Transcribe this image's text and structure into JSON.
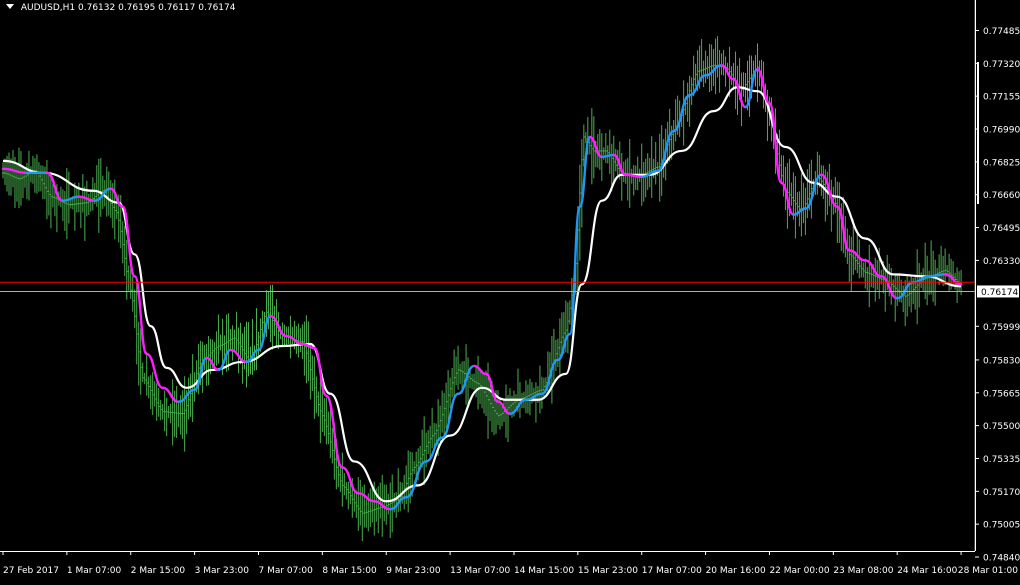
{
  "header": {
    "symbol": "AUDUSD,H1",
    "ohlc": "0.76132 0.76195 0.76117 0.76174"
  },
  "colors": {
    "background": "#000000",
    "axis": "#ffffff",
    "bars": "#4caf50",
    "ma_slow": "#ffffff",
    "ma_fast_down": "#ff1cff",
    "ma_fast_up": "#2196f3",
    "bid_line": "#ff0000",
    "price_line": "#b0b0b0",
    "price_label_bg": "#ffffff",
    "price_label_text": "#000000"
  },
  "chart_data": {
    "type": "line",
    "title": "",
    "series_style": "ohlc_bars_with_moving_averages",
    "current_price": 0.76174,
    "current_price_label": "0.76174",
    "bid_line": 0.7622,
    "ylim": [
      0.7484,
      0.7758
    ],
    "y_ticks": [
      0.77485,
      0.7732,
      0.77155,
      0.7699,
      0.76825,
      0.7666,
      0.76495,
      0.7633,
      0.75999,
      0.7583,
      0.75665,
      0.755,
      0.75335,
      0.7517,
      0.75005,
      0.7484
    ],
    "y_tick_labels": [
      "0.77485",
      "0.77320",
      "0.77155",
      "0.76990",
      "0.76825",
      "0.76660",
      "0.76495",
      "0.76330",
      "0.75999",
      "0.75830",
      "0.75665",
      "0.75500",
      "0.75335",
      "0.75170",
      "0.75005",
      "0.74840"
    ],
    "x_tick_labels": [
      "27 Feb 2017",
      "1 Mar 07:00",
      "2 Mar 15:00",
      "3 Mar 23:00",
      "7 Mar 07:00",
      "8 Mar 15:00",
      "9 Mar 23:00",
      "13 Mar 07:00",
      "14 Mar 15:00",
      "15 Mar 23:00",
      "17 Mar 07:00",
      "20 Mar 16:00",
      "22 Mar 00:00",
      "23 Mar 08:00",
      "24 Mar 16:00",
      "28 Mar 01:00"
    ],
    "x_tick_bars": [
      0,
      32,
      64,
      96,
      128,
      160,
      192,
      224,
      256,
      288,
      320,
      352,
      384,
      416,
      448,
      480
    ],
    "bar_count": 481,
    "price_path": [
      {
        "bar": 0,
        "price": 0.7677
      },
      {
        "bar": 8,
        "price": 0.7674
      },
      {
        "bar": 16,
        "price": 0.7678
      },
      {
        "bar": 24,
        "price": 0.7665
      },
      {
        "bar": 33,
        "price": 0.7661
      },
      {
        "bar": 42,
        "price": 0.7662
      },
      {
        "bar": 50,
        "price": 0.7668
      },
      {
        "bar": 57,
        "price": 0.7657
      },
      {
        "bar": 64,
        "price": 0.7618
      },
      {
        "bar": 70,
        "price": 0.7574
      },
      {
        "bar": 80,
        "price": 0.7557
      },
      {
        "bar": 90,
        "price": 0.7556
      },
      {
        "bar": 100,
        "price": 0.7583
      },
      {
        "bar": 108,
        "price": 0.759
      },
      {
        "bar": 116,
        "price": 0.7594
      },
      {
        "bar": 124,
        "price": 0.7582
      },
      {
        "bar": 132,
        "price": 0.7607
      },
      {
        "bar": 140,
        "price": 0.7595
      },
      {
        "bar": 150,
        "price": 0.7592
      },
      {
        "bar": 160,
        "price": 0.7555
      },
      {
        "bar": 170,
        "price": 0.752
      },
      {
        "bar": 180,
        "price": 0.7506
      },
      {
        "bar": 190,
        "price": 0.7509
      },
      {
        "bar": 198,
        "price": 0.7513
      },
      {
        "bar": 206,
        "price": 0.7529
      },
      {
        "bar": 216,
        "price": 0.7546
      },
      {
        "bar": 228,
        "price": 0.7578
      },
      {
        "bar": 238,
        "price": 0.7571
      },
      {
        "bar": 248,
        "price": 0.7555
      },
      {
        "bar": 258,
        "price": 0.7563
      },
      {
        "bar": 270,
        "price": 0.7568
      },
      {
        "bar": 282,
        "price": 0.7598
      },
      {
        "bar": 286,
        "price": 0.762
      },
      {
        "bar": 291,
        "price": 0.7695
      },
      {
        "bar": 296,
        "price": 0.7688
      },
      {
        "bar": 302,
        "price": 0.7688
      },
      {
        "bar": 310,
        "price": 0.7677
      },
      {
        "bar": 318,
        "price": 0.7675
      },
      {
        "bar": 328,
        "price": 0.768
      },
      {
        "bar": 338,
        "price": 0.7702
      },
      {
        "bar": 348,
        "price": 0.7728
      },
      {
        "bar": 356,
        "price": 0.7731
      },
      {
        "bar": 362,
        "price": 0.773
      },
      {
        "bar": 370,
        "price": 0.7719
      },
      {
        "bar": 378,
        "price": 0.773
      },
      {
        "bar": 384,
        "price": 0.7705
      },
      {
        "bar": 392,
        "price": 0.7668
      },
      {
        "bar": 400,
        "price": 0.7658
      },
      {
        "bar": 408,
        "price": 0.7675
      },
      {
        "bar": 416,
        "price": 0.7664
      },
      {
        "bar": 424,
        "price": 0.7636
      },
      {
        "bar": 432,
        "price": 0.7627
      },
      {
        "bar": 442,
        "price": 0.7623
      },
      {
        "bar": 452,
        "price": 0.7615
      },
      {
        "bar": 462,
        "price": 0.7624
      },
      {
        "bar": 472,
        "price": 0.7628
      },
      {
        "bar": 480,
        "price": 0.7621
      }
    ],
    "ma_slow_points": [
      {
        "bar": 0,
        "price": 0.7683
      },
      {
        "bar": 20,
        "price": 0.7677
      },
      {
        "bar": 45,
        "price": 0.7668
      },
      {
        "bar": 58,
        "price": 0.7662
      },
      {
        "bar": 66,
        "price": 0.7636
      },
      {
        "bar": 74,
        "price": 0.76
      },
      {
        "bar": 82,
        "price": 0.7579
      },
      {
        "bar": 92,
        "price": 0.7569
      },
      {
        "bar": 105,
        "price": 0.7578
      },
      {
        "bar": 120,
        "price": 0.7582
      },
      {
        "bar": 140,
        "price": 0.759
      },
      {
        "bar": 154,
        "price": 0.7591
      },
      {
        "bar": 164,
        "price": 0.7566
      },
      {
        "bar": 176,
        "price": 0.7532
      },
      {
        "bar": 192,
        "price": 0.7512
      },
      {
        "bar": 208,
        "price": 0.752
      },
      {
        "bar": 224,
        "price": 0.7545
      },
      {
        "bar": 240,
        "price": 0.7569
      },
      {
        "bar": 252,
        "price": 0.7563
      },
      {
        "bar": 268,
        "price": 0.7563
      },
      {
        "bar": 282,
        "price": 0.7576
      },
      {
        "bar": 290,
        "price": 0.7621
      },
      {
        "bar": 300,
        "price": 0.7663
      },
      {
        "bar": 310,
        "price": 0.7676
      },
      {
        "bar": 324,
        "price": 0.7676
      },
      {
        "bar": 340,
        "price": 0.7688
      },
      {
        "bar": 356,
        "price": 0.7708
      },
      {
        "bar": 368,
        "price": 0.772
      },
      {
        "bar": 378,
        "price": 0.7718
      },
      {
        "bar": 392,
        "price": 0.769
      },
      {
        "bar": 406,
        "price": 0.7672
      },
      {
        "bar": 418,
        "price": 0.7665
      },
      {
        "bar": 432,
        "price": 0.7644
      },
      {
        "bar": 446,
        "price": 0.7626
      },
      {
        "bar": 462,
        "price": 0.7625
      },
      {
        "bar": 480,
        "price": 0.762
      }
    ],
    "ma_fast_points": [
      {
        "bar": 0,
        "price": 0.7679
      },
      {
        "bar": 12,
        "price": 0.7677
      },
      {
        "bar": 22,
        "price": 0.7677
      },
      {
        "bar": 30,
        "price": 0.7663
      },
      {
        "bar": 38,
        "price": 0.7665
      },
      {
        "bar": 46,
        "price": 0.7663
      },
      {
        "bar": 54,
        "price": 0.7669
      },
      {
        "bar": 60,
        "price": 0.766
      },
      {
        "bar": 66,
        "price": 0.7625
      },
      {
        "bar": 72,
        "price": 0.7586
      },
      {
        "bar": 80,
        "price": 0.7569
      },
      {
        "bar": 88,
        "price": 0.7562
      },
      {
        "bar": 96,
        "price": 0.7568
      },
      {
        "bar": 102,
        "price": 0.7584
      },
      {
        "bar": 108,
        "price": 0.7578
      },
      {
        "bar": 114,
        "price": 0.7588
      },
      {
        "bar": 122,
        "price": 0.7582
      },
      {
        "bar": 128,
        "price": 0.7588
      },
      {
        "bar": 134,
        "price": 0.7605
      },
      {
        "bar": 142,
        "price": 0.7595
      },
      {
        "bar": 150,
        "price": 0.7591
      },
      {
        "bar": 156,
        "price": 0.7589
      },
      {
        "bar": 162,
        "price": 0.7565
      },
      {
        "bar": 170,
        "price": 0.7529
      },
      {
        "bar": 178,
        "price": 0.7516
      },
      {
        "bar": 186,
        "price": 0.7512
      },
      {
        "bar": 194,
        "price": 0.7508
      },
      {
        "bar": 202,
        "price": 0.7514
      },
      {
        "bar": 212,
        "price": 0.7532
      },
      {
        "bar": 220,
        "price": 0.7544
      },
      {
        "bar": 228,
        "price": 0.7566
      },
      {
        "bar": 236,
        "price": 0.758
      },
      {
        "bar": 242,
        "price": 0.7576
      },
      {
        "bar": 248,
        "price": 0.7562
      },
      {
        "bar": 254,
        "price": 0.7556
      },
      {
        "bar": 262,
        "price": 0.7563
      },
      {
        "bar": 270,
        "price": 0.7566
      },
      {
        "bar": 278,
        "price": 0.7583
      },
      {
        "bar": 284,
        "price": 0.7596
      },
      {
        "bar": 289,
        "price": 0.766
      },
      {
        "bar": 294,
        "price": 0.7695
      },
      {
        "bar": 300,
        "price": 0.7685
      },
      {
        "bar": 306,
        "price": 0.7686
      },
      {
        "bar": 312,
        "price": 0.7676
      },
      {
        "bar": 320,
        "price": 0.7675
      },
      {
        "bar": 328,
        "price": 0.7678
      },
      {
        "bar": 336,
        "price": 0.7698
      },
      {
        "bar": 344,
        "price": 0.7716
      },
      {
        "bar": 352,
        "price": 0.7726
      },
      {
        "bar": 360,
        "price": 0.7731
      },
      {
        "bar": 366,
        "price": 0.7724
      },
      {
        "bar": 372,
        "price": 0.771
      },
      {
        "bar": 378,
        "price": 0.7729
      },
      {
        "bar": 384,
        "price": 0.7712
      },
      {
        "bar": 390,
        "price": 0.7672
      },
      {
        "bar": 396,
        "price": 0.7656
      },
      {
        "bar": 402,
        "price": 0.7659
      },
      {
        "bar": 410,
        "price": 0.7676
      },
      {
        "bar": 418,
        "price": 0.766
      },
      {
        "bar": 424,
        "price": 0.7638
      },
      {
        "bar": 432,
        "price": 0.7633
      },
      {
        "bar": 440,
        "price": 0.7625
      },
      {
        "bar": 448,
        "price": 0.7614
      },
      {
        "bar": 456,
        "price": 0.7622
      },
      {
        "bar": 464,
        "price": 0.7625
      },
      {
        "bar": 472,
        "price": 0.7626
      },
      {
        "bar": 480,
        "price": 0.7621
      }
    ]
  }
}
